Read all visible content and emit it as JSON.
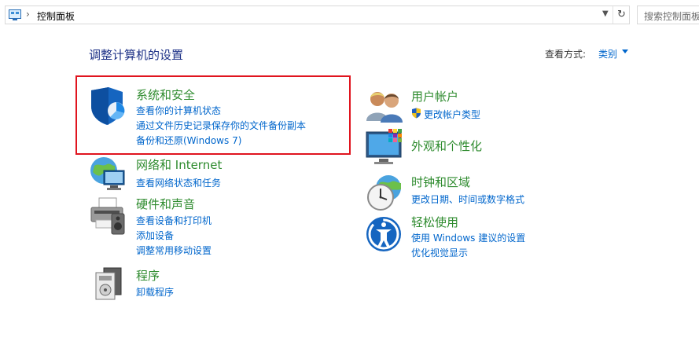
{
  "address": {
    "path": "控制面板",
    "search_placeholder": "搜索控制面板"
  },
  "header": {
    "title": "调整计算机的设置",
    "view_by_label": "查看方式:",
    "view_by_value": "类别"
  },
  "categories": [
    {
      "title": "系统和安全",
      "links": [
        "查看你的计算机状态",
        "通过文件历史记录保存你的文件备份副本",
        "备份和还原(Windows 7)"
      ]
    },
    {
      "title": "网络和 Internet",
      "links": [
        "查看网络状态和任务"
      ]
    },
    {
      "title": "硬件和声音",
      "links": [
        "查看设备和打印机",
        "添加设备",
        "调整常用移动设置"
      ]
    },
    {
      "title": "程序",
      "links": [
        "卸载程序"
      ]
    },
    {
      "title": "用户帐户",
      "links": [
        "更改帐户类型"
      ]
    },
    {
      "title": "外观和个性化",
      "links": []
    },
    {
      "title": "时钟和区域",
      "links": [
        "更改日期、时间或数字格式"
      ]
    },
    {
      "title": "轻松使用",
      "links": [
        "使用 Windows 建议的设置",
        "优化视觉显示"
      ]
    }
  ]
}
